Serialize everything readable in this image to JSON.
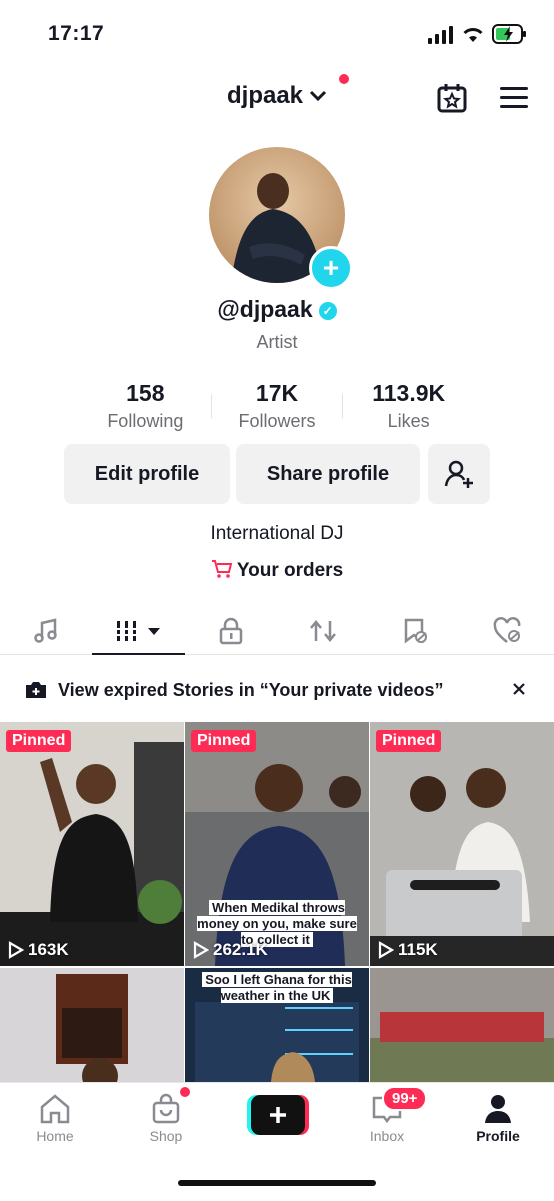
{
  "status_bar": {
    "time": "17:17"
  },
  "header": {
    "username": "djpaak"
  },
  "profile": {
    "handle": "@djpaak",
    "category": "Artist",
    "stats": [
      {
        "value": "158",
        "label": "Following"
      },
      {
        "value": "17K",
        "label": "Followers"
      },
      {
        "value": "113.9K",
        "label": "Likes"
      }
    ],
    "edit_label": "Edit profile",
    "share_label": "Share profile",
    "bio": "International DJ",
    "orders_label": "Your orders"
  },
  "banner": {
    "text": "View expired Stories in “Your private videos”"
  },
  "videos": [
    {
      "pinned": "Pinned",
      "views": "163K"
    },
    {
      "pinned": "Pinned",
      "views": "262.1K",
      "caption": "When Medikal throws money on you, make sure to collect it"
    },
    {
      "pinned": "Pinned",
      "views": "115K"
    },
    {},
    {
      "caption": "Soo I left Ghana for this weather in the UK"
    },
    {}
  ],
  "nav": {
    "home": "Home",
    "shop": "Shop",
    "inbox": "Inbox",
    "inbox_badge": "99+",
    "profile": "Profile"
  },
  "colors": {
    "accent": "#fe2c55",
    "cyan": "#20d5ec"
  }
}
